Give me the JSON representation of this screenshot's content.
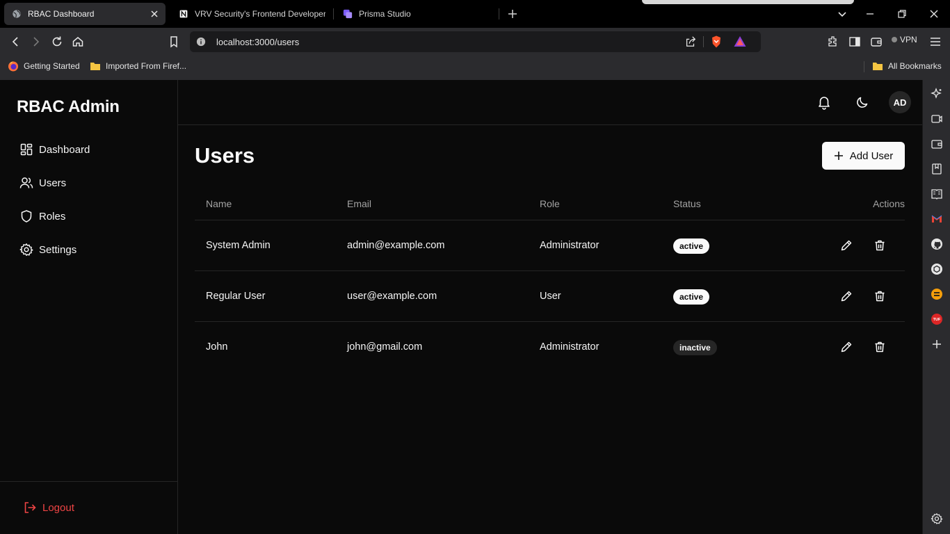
{
  "browser": {
    "tabs": [
      {
        "title": "RBAC Dashboard",
        "active": true
      },
      {
        "title": "VRV Security's Frontend Developer I",
        "active": false
      },
      {
        "title": "Prisma Studio",
        "active": false
      }
    ],
    "url": "localhost:3000/users",
    "vpn_label": "VPN",
    "bookmarks": [
      {
        "label": "Getting Started",
        "icon": "firefox-icon"
      },
      {
        "label": "Imported From Firef...",
        "icon": "folder-icon"
      }
    ],
    "all_bookmarks_label": "All Bookmarks"
  },
  "sidebar": {
    "brand": "RBAC Admin",
    "items": [
      {
        "label": "Dashboard",
        "icon": "dashboard-icon"
      },
      {
        "label": "Users",
        "icon": "users-icon"
      },
      {
        "label": "Roles",
        "icon": "shield-icon"
      },
      {
        "label": "Settings",
        "icon": "gear-icon"
      }
    ],
    "logout_label": "Logout"
  },
  "header": {
    "avatar_initials": "AD"
  },
  "main": {
    "title": "Users",
    "add_button_label": "Add User",
    "table": {
      "columns": [
        "Name",
        "Email",
        "Role",
        "Status",
        "Actions"
      ],
      "rows": [
        {
          "name": "System Admin",
          "email": "admin@example.com",
          "role": "Administrator",
          "status": "active"
        },
        {
          "name": "Regular User",
          "email": "user@example.com",
          "role": "User",
          "status": "active"
        },
        {
          "name": "John",
          "email": "john@gmail.com",
          "role": "Administrator",
          "status": "inactive"
        }
      ]
    }
  },
  "colors": {
    "background": "#0a0a0a",
    "border": "#262626",
    "logout": "#ef4444",
    "badge_active": "#fafafa",
    "badge_inactive": "#262626"
  }
}
